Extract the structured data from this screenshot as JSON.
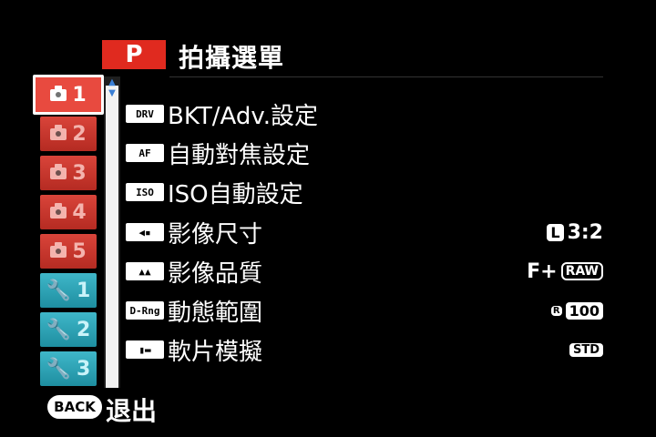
{
  "header": {
    "mode_badge": "P",
    "title": "拍攝選單"
  },
  "tabs": [
    {
      "label": "1",
      "kind": "camera",
      "active": true
    },
    {
      "label": "2",
      "kind": "camera",
      "active": false
    },
    {
      "label": "3",
      "kind": "camera",
      "active": false
    },
    {
      "label": "4",
      "kind": "camera",
      "active": false
    },
    {
      "label": "5",
      "kind": "camera",
      "active": false
    },
    {
      "label": "1",
      "kind": "wrench",
      "active": false
    },
    {
      "label": "2",
      "kind": "wrench",
      "active": false
    },
    {
      "label": "3",
      "kind": "wrench",
      "active": false
    }
  ],
  "menu": {
    "items": [
      {
        "icon": "DRV",
        "label": "BKT/Adv.設定",
        "value": ""
      },
      {
        "icon": "AF",
        "label": "自動對焦設定",
        "value": ""
      },
      {
        "icon": "ISO",
        "label": "ISO自動設定",
        "value": ""
      },
      {
        "icon": "◀▪",
        "label": "影像尺寸",
        "value_badge": "L",
        "value": "3:2"
      },
      {
        "icon": "▲▲",
        "label": "影像品質",
        "value": "F+",
        "value_badge": "RAW"
      },
      {
        "icon": "D-Rng",
        "label": "動態範圍",
        "value_badge": "R",
        "value": "100"
      },
      {
        "icon": "▮▬",
        "label": "軟片模擬",
        "value": "STD"
      }
    ]
  },
  "footer": {
    "back_button": "BACK",
    "back_label": "退出"
  },
  "colors": {
    "camera_tab": "#d9443a",
    "settings_tab": "#2aa3b6",
    "mode_badge": "#e02a1f",
    "scroll_arrow": "#3a7fd5"
  }
}
